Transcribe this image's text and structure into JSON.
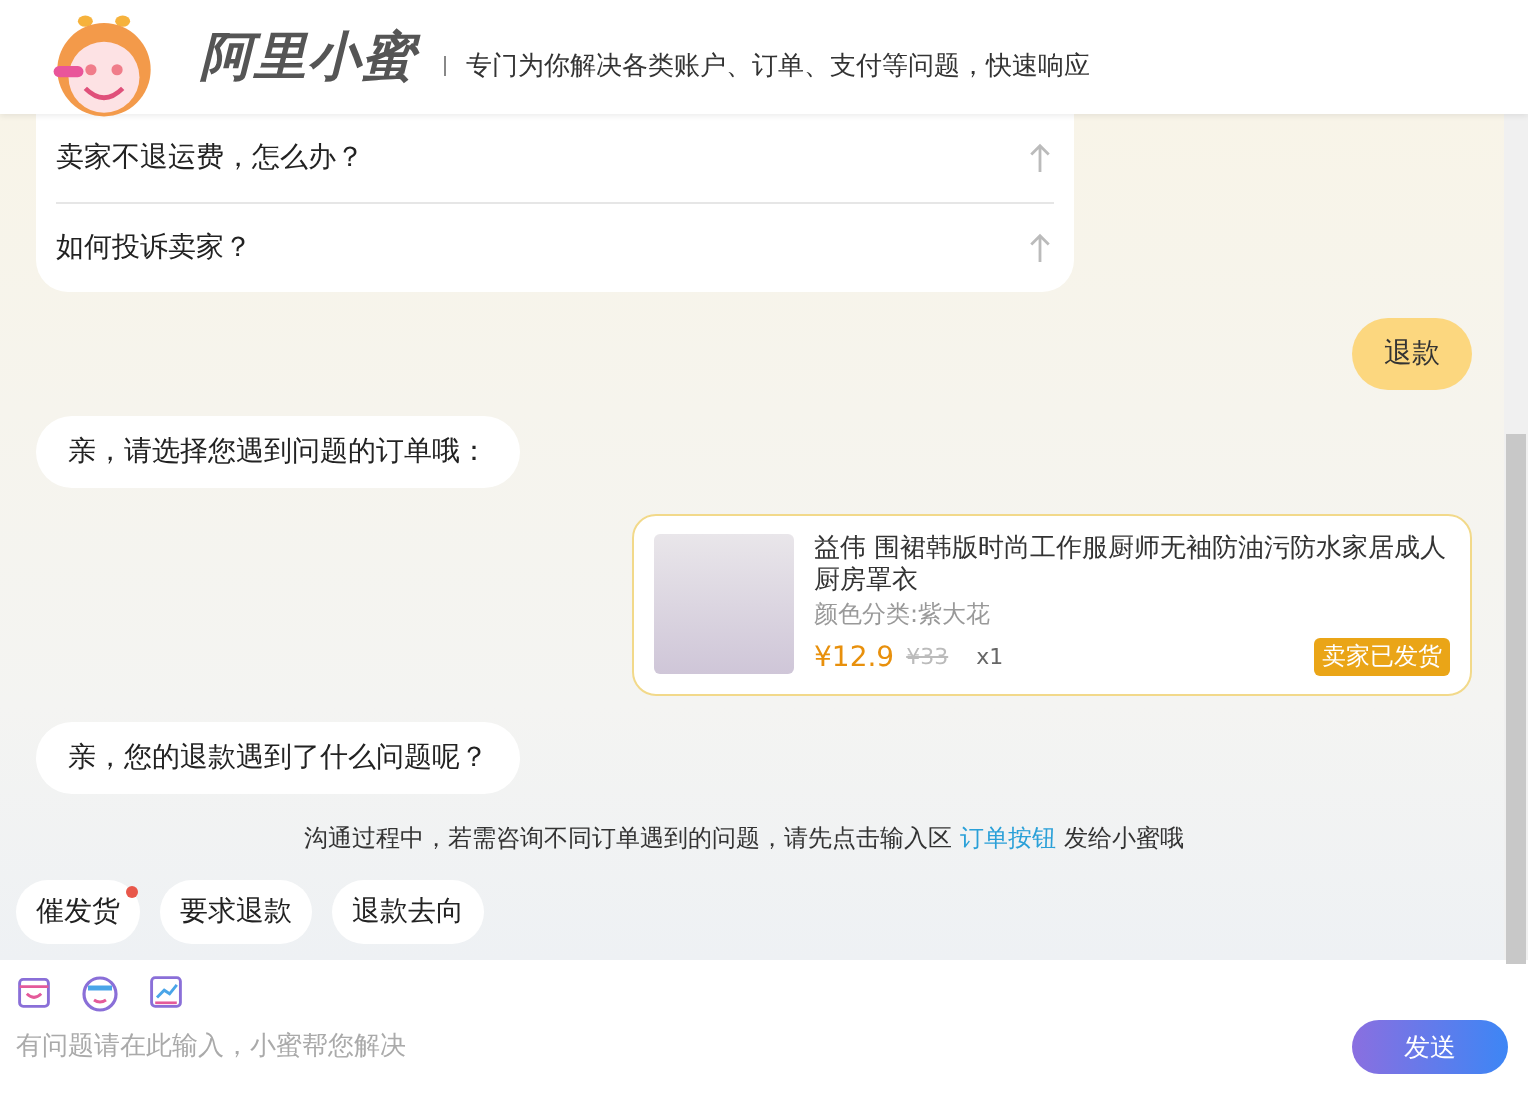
{
  "header": {
    "title": "阿里小蜜",
    "tagline": "专门为你解决各类账户、订单、支付等问题，快速响应"
  },
  "faq": [
    "卖家不退运费，怎么办？",
    "如何投诉卖家？"
  ],
  "messages": [
    {
      "kind": "user",
      "text": "退款"
    },
    {
      "kind": "bot",
      "text": "亲，请选择您遇到问题的订单哦："
    },
    {
      "kind": "order",
      "title": "益伟 围裙韩版时尚工作服厨师无袖防油污防水家居成人厨房罩衣",
      "variant": "颜色分类:紫大花",
      "price": "¥12.9",
      "original_price": "¥33",
      "quantity": "x1",
      "status": "卖家已发货"
    },
    {
      "kind": "bot",
      "text": "亲，您的退款遇到了什么问题呢？"
    }
  ],
  "notice": {
    "before": "沟通过程中，若需咨询不同订单遇到的问题，请先点击输入区 ",
    "link": "订单按钮",
    "after": " 发给小蜜哦"
  },
  "quick_replies": [
    {
      "label": "催发货",
      "badge": true
    },
    {
      "label": "要求退款",
      "badge": false
    },
    {
      "label": "退款去向",
      "badge": false
    }
  ],
  "input": {
    "placeholder": "有问题请在此输入，小蜜帮您解决"
  },
  "send_button": "发送"
}
